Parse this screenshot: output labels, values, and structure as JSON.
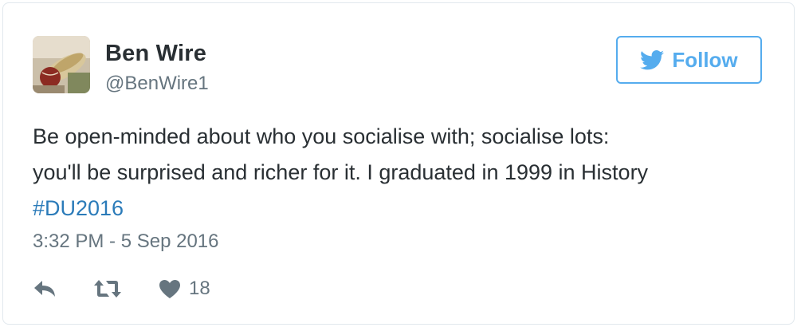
{
  "tweet": {
    "author_name": "Ben Wire",
    "author_handle": "@BenWire1",
    "text_lines": [
      "Be open-minded about who you socialise with; socialise lots:",
      "you'll be surprised and richer for it. I graduated in 1999 in History"
    ],
    "hashtag": "#DU2016",
    "timestamp": "3:32 PM - 5 Sep 2016",
    "like_count": "18"
  },
  "follow_button": {
    "label": "Follow"
  },
  "colors": {
    "accent": "#55acee",
    "link": "#2b7bb9",
    "text": "#292f33",
    "muted": "#66757f",
    "border": "#e1e8ed"
  },
  "icons": {
    "follow": "bird-icon",
    "reply": "reply-icon",
    "retweet": "retweet-icon",
    "like": "heart-icon"
  }
}
